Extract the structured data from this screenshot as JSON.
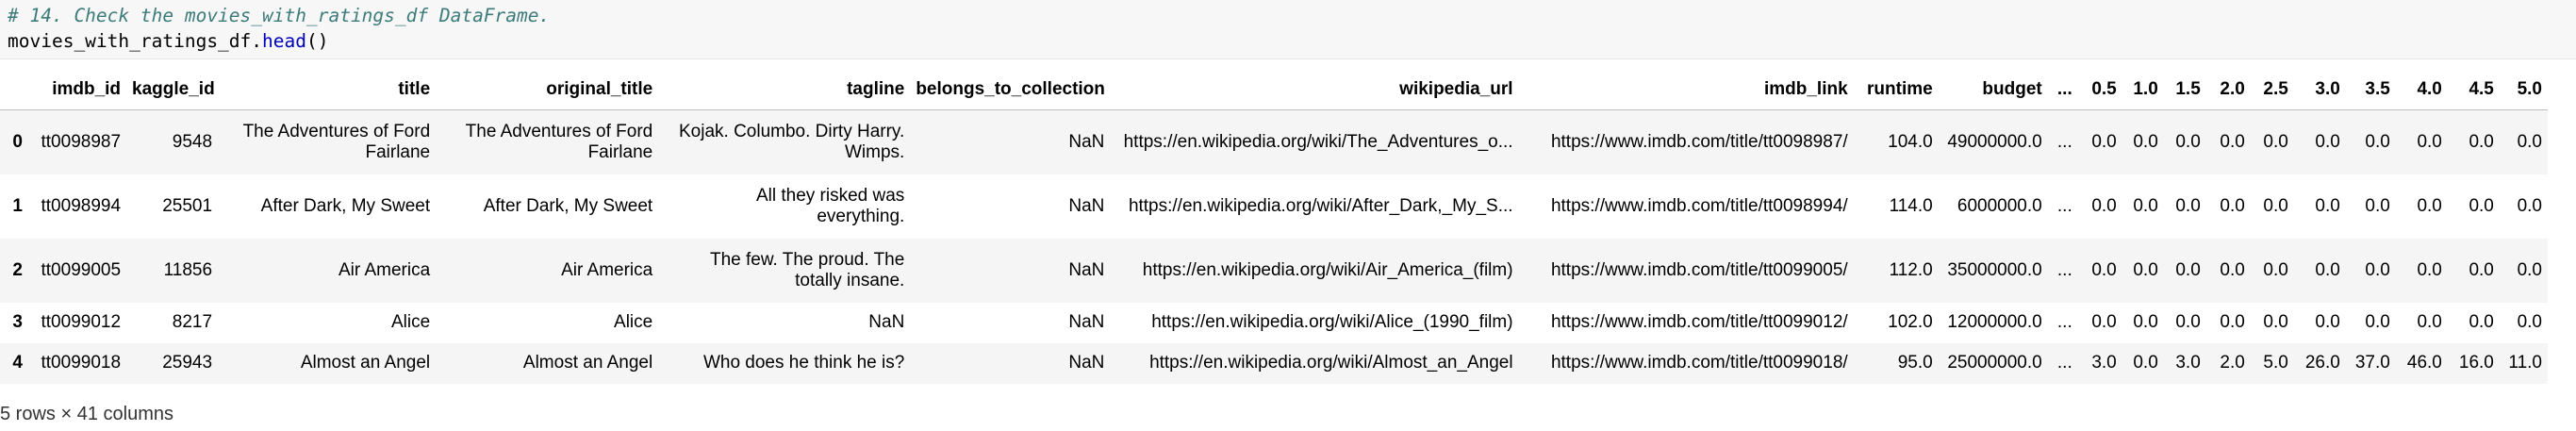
{
  "cell": {
    "comment": "# 14. Check the movies_with_ratings_df DataFrame.",
    "code_var": "movies_with_ratings_df",
    "code_dot": ".",
    "code_method": "head",
    "code_parens": "()"
  },
  "table": {
    "columns": [
      "imdb_id",
      "kaggle_id",
      "title",
      "original_title",
      "tagline",
      "belongs_to_collection",
      "wikipedia_url",
      "imdb_link",
      "runtime",
      "budget",
      "...",
      "0.5",
      "1.0",
      "1.5",
      "2.0",
      "2.5",
      "3.0",
      "3.5",
      "4.0",
      "4.5",
      "5.0"
    ],
    "rows": [
      {
        "index": "0",
        "cells": [
          "tt0098987",
          "9548",
          "The Adventures of Ford Fairlane",
          "The Adventures of Ford Fairlane",
          "Kojak. Columbo. Dirty Harry. Wimps.",
          "NaN",
          "https://en.wikipedia.org/wiki/The_Adventures_o...",
          "https://www.imdb.com/title/tt0098987/",
          "104.0",
          "49000000.0",
          "...",
          "0.0",
          "0.0",
          "0.0",
          "0.0",
          "0.0",
          "0.0",
          "0.0",
          "0.0",
          "0.0",
          "0.0"
        ]
      },
      {
        "index": "1",
        "cells": [
          "tt0098994",
          "25501",
          "After Dark, My Sweet",
          "After Dark, My Sweet",
          "All they risked was everything.",
          "NaN",
          "https://en.wikipedia.org/wiki/After_Dark,_My_S...",
          "https://www.imdb.com/title/tt0098994/",
          "114.0",
          "6000000.0",
          "...",
          "0.0",
          "0.0",
          "0.0",
          "0.0",
          "0.0",
          "0.0",
          "0.0",
          "0.0",
          "0.0",
          "0.0"
        ]
      },
      {
        "index": "2",
        "cells": [
          "tt0099005",
          "11856",
          "Air America",
          "Air America",
          "The few. The proud. The totally insane.",
          "NaN",
          "https://en.wikipedia.org/wiki/Air_America_(film)",
          "https://www.imdb.com/title/tt0099005/",
          "112.0",
          "35000000.0",
          "...",
          "0.0",
          "0.0",
          "0.0",
          "0.0",
          "0.0",
          "0.0",
          "0.0",
          "0.0",
          "0.0",
          "0.0"
        ]
      },
      {
        "index": "3",
        "cells": [
          "tt0099012",
          "8217",
          "Alice",
          "Alice",
          "NaN",
          "NaN",
          "https://en.wikipedia.org/wiki/Alice_(1990_film)",
          "https://www.imdb.com/title/tt0099012/",
          "102.0",
          "12000000.0",
          "...",
          "0.0",
          "0.0",
          "0.0",
          "0.0",
          "0.0",
          "0.0",
          "0.0",
          "0.0",
          "0.0",
          "0.0"
        ]
      },
      {
        "index": "4",
        "cells": [
          "tt0099018",
          "25943",
          "Almost an Angel",
          "Almost an Angel",
          "Who does he think he is?",
          "NaN",
          "https://en.wikipedia.org/wiki/Almost_an_Angel",
          "https://www.imdb.com/title/tt0099018/",
          "95.0",
          "25000000.0",
          "...",
          "3.0",
          "0.0",
          "3.0",
          "2.0",
          "5.0",
          "26.0",
          "37.0",
          "46.0",
          "16.0",
          "11.0"
        ]
      }
    ]
  },
  "footer": "5 rows × 41 columns"
}
